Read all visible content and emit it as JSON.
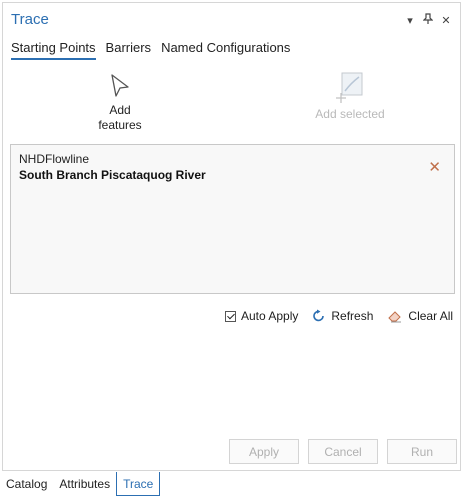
{
  "pane": {
    "title": "Trace",
    "controls": [
      "chevron-down-icon",
      "pin-icon",
      "close-icon"
    ]
  },
  "tabs": [
    {
      "label": "Starting Points",
      "active": true
    },
    {
      "label": "Barriers",
      "active": false
    },
    {
      "label": "Named Configurations",
      "active": false
    }
  ],
  "tools": {
    "add_features": {
      "line1": "Add",
      "line2": "features",
      "icon": "cursor-arrow-icon"
    },
    "add_selected": {
      "label": "Add selected",
      "icon": "add-selected-icon",
      "enabled": false
    }
  },
  "starting_points": [
    {
      "layer": "NHDFlowline",
      "feature": "South Branch Piscataquog River"
    }
  ],
  "options": {
    "auto_apply": {
      "label": "Auto Apply",
      "checked": true
    },
    "refresh": {
      "label": "Refresh",
      "icon": "refresh-icon"
    },
    "clear_all": {
      "label": "Clear All",
      "icon": "eraser-icon"
    }
  },
  "buttons": {
    "apply": "Apply",
    "cancel": "Cancel",
    "run": "Run"
  },
  "bottom_tabs": [
    {
      "label": "Catalog",
      "active": false
    },
    {
      "label": "Attributes",
      "active": false
    },
    {
      "label": "Trace",
      "active": true
    }
  ],
  "colors": {
    "accent": "#2c6fb2",
    "remove": "#c0704b",
    "disabled_text": "#b0b0b0"
  }
}
